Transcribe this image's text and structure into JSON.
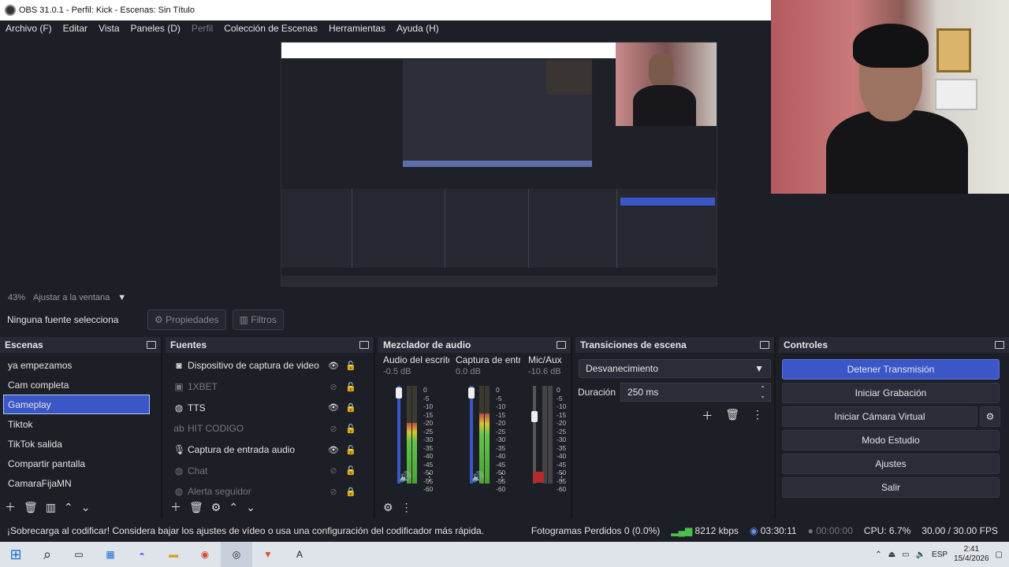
{
  "window": {
    "title": "OBS 31.0.1 - Perfil: Kick - Escenas: Sin Título"
  },
  "menu": [
    {
      "label": "Archivo (F)",
      "enabled": true
    },
    {
      "label": "Editar",
      "enabled": true
    },
    {
      "label": "Vista",
      "enabled": true
    },
    {
      "label": "Paneles (D)",
      "enabled": true
    },
    {
      "label": "Perfil",
      "enabled": false
    },
    {
      "label": "Colección de Escenas",
      "enabled": true
    },
    {
      "label": "Herramientas",
      "enabled": true
    },
    {
      "label": "Ayuda (H)",
      "enabled": true
    }
  ],
  "zoom": {
    "percent": "43%",
    "fit_label": "Ajustar a la ventana"
  },
  "source_toolbar": {
    "message": "Ninguna fuente selecciona",
    "properties": "Propiedades",
    "filters": "Filtros"
  },
  "scenes": {
    "title": "Escenas",
    "items": [
      "ya empezamos",
      "Cam completa",
      "Gameplay",
      "Tiktok",
      "TikTok salida",
      "Compartir pantalla",
      "CamaraFijaMN"
    ],
    "selected": "Gameplay"
  },
  "sources": {
    "title": "Fuentes",
    "items": [
      {
        "name": "Dispositivo de captura de video",
        "icon": "camera-icon",
        "visible": true,
        "locked": false
      },
      {
        "name": "1XBET",
        "icon": "image-icon",
        "visible": false,
        "locked": false
      },
      {
        "name": "TTS",
        "icon": "browser-icon",
        "visible": true,
        "locked": true
      },
      {
        "name": "HIT CODIGO",
        "icon": "text-icon",
        "visible": false,
        "locked": false
      },
      {
        "name": "Captura de entrada audio",
        "icon": "mic-icon",
        "visible": true,
        "locked": false
      },
      {
        "name": "Chat",
        "icon": "browser-icon",
        "visible": false,
        "locked": false
      },
      {
        "name": "Alerta seguidor",
        "icon": "browser-icon",
        "visible": false,
        "locked": true
      }
    ]
  },
  "mixer": {
    "title": "Mezclador de audio",
    "channels": [
      {
        "name": "Audio del escrito",
        "db": "-0.5 dB",
        "level": 0.62
      },
      {
        "name": "Captura de entra",
        "db": "0.0 dB",
        "level": 0.72
      },
      {
        "name": "Mic/Aux",
        "db": "-10.6 dB",
        "level": 0.5
      }
    ],
    "scale": [
      "0",
      "-5",
      "-10",
      "-15",
      "-20",
      "-25",
      "-30",
      "-35",
      "-40",
      "-45",
      "-50",
      "-55",
      "-60"
    ]
  },
  "transitions": {
    "title": "Transiciones de escena",
    "selected": "Desvanecimiento",
    "duration_label": "Duración",
    "duration_value": "250 ms"
  },
  "controls": {
    "title": "Controles",
    "buttons": [
      "Detener Transmisión",
      "Iniciar Grabación",
      "Iniciar Cámara Virtual",
      "Modo Estudio",
      "Ajustes",
      "Salir"
    ]
  },
  "status": {
    "warning": "¡Sobrecarga al codificar! Considera bajar los ajustes de vídeo o usa una configuración del codificador más rápida.",
    "dropped": "Fotogramas Perdidos 0 (0.0%)",
    "bitrate": "8212 kbps",
    "stream_time": "03:30:11",
    "rec_time": "00:00:00",
    "cpu": "CPU: 6.7%",
    "fps": "30.00 / 30.00 FPS"
  },
  "taskbar": {
    "lang": "ESP",
    "time": "2:41",
    "date": "15/4/2026"
  },
  "colors": {
    "accent": "#3b57c7",
    "bg": "#1d1f26",
    "dock_header": "#272a35"
  }
}
